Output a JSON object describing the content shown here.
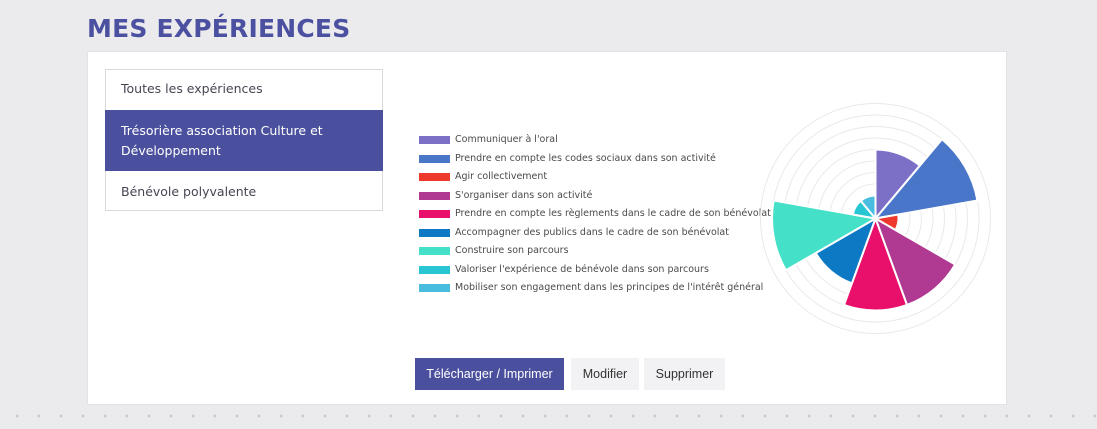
{
  "page": {
    "title": "MES EXPÉRIENCES"
  },
  "experiences": [
    {
      "label": "Toutes les expériences",
      "active": false
    },
    {
      "label": "Trésorière association Culture et Développement",
      "active": true
    },
    {
      "label": "Bénévole polyvalente",
      "active": false
    }
  ],
  "buttons": {
    "download_label": "Télécharger / Imprimer",
    "modify_label": "Modifier",
    "delete_label": "Supprimer"
  },
  "chart_data": {
    "type": "polar-area",
    "title": "",
    "legend_position": "left",
    "grid": true,
    "rmax": 10,
    "grid_rings": 10,
    "start_angle": "top",
    "direction": "clockwise",
    "series": [
      {
        "name": "Communiquer à l'oral",
        "value": 6,
        "color": "#7b70c6"
      },
      {
        "name": "Prendre en compte les codes sociaux dans son activité",
        "value": 9,
        "color": "#4a76c9"
      },
      {
        "name": "Agir collectivement",
        "value": 2,
        "color": "#ee3a2c"
      },
      {
        "name": "S'organiser dans son activité",
        "value": 8,
        "color": "#b03a92"
      },
      {
        "name": "Prendre en compte les règlements dans le cadre de son bénévolat",
        "value": 8,
        "color": "#e8106a"
      },
      {
        "name": "Accompagner des publics dans le cadre de son bénévolat",
        "value": 6,
        "color": "#0d78c3"
      },
      {
        "name": "Construire son parcours",
        "value": 9,
        "color": "#44e0c7"
      },
      {
        "name": "Valoriser l'expérience de bénévole dans son parcours",
        "value": 2,
        "color": "#28c6d2"
      },
      {
        "name": "Mobiliser son engagement dans les principes de l'intérêt général",
        "value": 2,
        "color": "#48bde0"
      }
    ]
  }
}
